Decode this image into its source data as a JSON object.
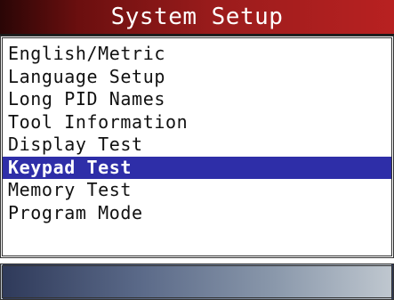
{
  "header": {
    "title": "System Setup"
  },
  "menu": {
    "items": [
      {
        "label": "English/Metric",
        "selected": false
      },
      {
        "label": "Language Setup",
        "selected": false
      },
      {
        "label": "Long PID Names",
        "selected": false
      },
      {
        "label": "Tool Information",
        "selected": false
      },
      {
        "label": "Display Test",
        "selected": false
      },
      {
        "label": "Keypad Test",
        "selected": true
      },
      {
        "label": "Memory Test",
        "selected": false
      },
      {
        "label": "Program Mode",
        "selected": false
      }
    ]
  },
  "colors": {
    "title_bar": "#9b1c1c",
    "selection": "#2e2ea8",
    "status_bar": "#5a6988"
  }
}
